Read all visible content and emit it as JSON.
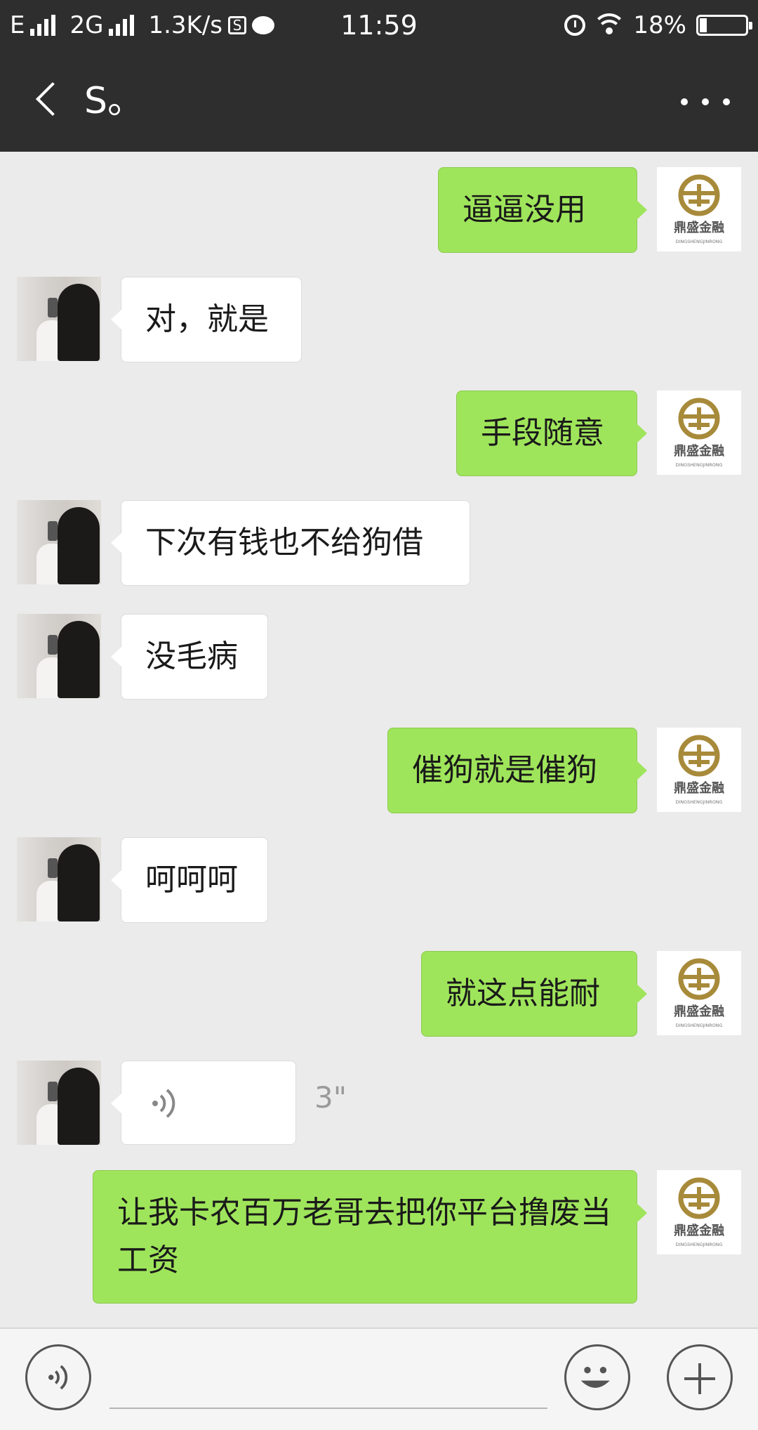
{
  "status_bar": {
    "carrier1": "E",
    "carrier2": "2G",
    "speed": "1.3K/s",
    "box_glyph": "S",
    "time": "11:59",
    "battery": "18%",
    "icons": [
      "signal-icon",
      "signal-icon",
      "sim-box-icon",
      "chat-notification-icon",
      "alarm-icon",
      "wifi-icon",
      "battery-icon"
    ]
  },
  "nav": {
    "title": "S。",
    "back_icon": "chevron-left-icon",
    "more_icon": "more-dots-icon"
  },
  "logo_text": {
    "brand": "鼎盛金融",
    "pinyin": "DINGSHENGJINRONG"
  },
  "messages": [
    {
      "side": "me",
      "text": "逼逼没用"
    },
    {
      "side": "friend",
      "text": "对，就是"
    },
    {
      "side": "me",
      "text": "手段随意"
    },
    {
      "side": "friend",
      "text": "下次有钱也不给狗借"
    },
    {
      "side": "friend",
      "text": "没毛病"
    },
    {
      "side": "me",
      "text": "催狗就是催狗"
    },
    {
      "side": "friend",
      "text": "呵呵呵"
    },
    {
      "side": "me",
      "text": "就这点能耐"
    },
    {
      "side": "friend",
      "type": "voice",
      "duration": "3\""
    },
    {
      "side": "me",
      "text": "让我卡农百万老哥去把你平台撸废当工资"
    }
  ],
  "input_bar": {
    "voice_icon": "voice-input-icon",
    "emoji_icon": "emoji-icon",
    "plus_icon": "plus-icon"
  },
  "colors": {
    "header_bg": "#2e2e2e",
    "chat_bg": "#ebebeb",
    "my_bubble": "#9fe55b",
    "friend_bubble": "#ffffff",
    "logo_gold": "#a78a3a"
  }
}
